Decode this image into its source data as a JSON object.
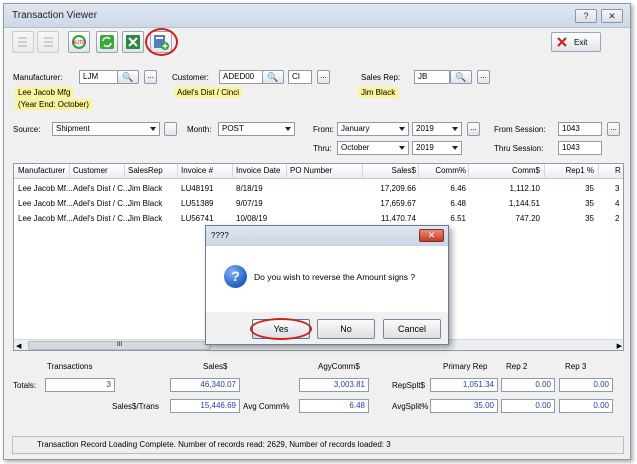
{
  "window": {
    "title": "Transaction Viewer",
    "help_label": "?",
    "close_label": "✕"
  },
  "toolbar": {
    "auto_label": "AUTO",
    "exit_label": "Exit"
  },
  "filters": {
    "manufacturer_label": "Manufacturer:",
    "manufacturer_value": "LJM",
    "manufacturer_name": "Lee Jacob Mfg",
    "manufacturer_note": "(Year End: October)",
    "customer_label": "Customer:",
    "customer_value": "ADED00",
    "customer_suffix": "CI",
    "customer_name": "Adel's Dist / Cinci",
    "salesrep_label": "Sales Rep:",
    "salesrep_value": "JB",
    "salesrep_name": "Jim Black",
    "more_label": "...",
    "source_label": "Source:",
    "source_value": "Shipment",
    "month_label": "Month:",
    "month_value": "POST",
    "from_label": "From:",
    "from_month": "January",
    "from_year": "2019",
    "thru_label": "Thru:",
    "thru_month": "October",
    "thru_year": "2019",
    "from_session_label": "From Session:",
    "from_session_value": "1043",
    "thru_session_label": "Thru Session:",
    "thru_session_value": "1043"
  },
  "grid": {
    "columns": [
      "Manufacturer",
      "Customer",
      "SalesRep",
      "Invoice #",
      "Invoice Date",
      "PO Number",
      "Sales$",
      "Comm%",
      "Comm$",
      "Rep1 %",
      "R"
    ],
    "rows": [
      [
        "Lee Jacob Mf...",
        "Adel's Dist / C...",
        "Jim Black",
        "LU48191",
        "8/18/19",
        "",
        "17,209.66",
        "6.46",
        "1,112.10",
        "35",
        "3"
      ],
      [
        "Lee Jacob Mf...",
        "Adel's Dist / C...",
        "Jim Black",
        "LU51389",
        "9/07/19",
        "",
        "17,659.67",
        "6.48",
        "1,144.51",
        "35",
        "4"
      ],
      [
        "Lee Jacob Mf...",
        "Adel's Dist / C...",
        "Jim Black",
        "LU56741",
        "10/08/19",
        "",
        "11,470.74",
        "6.51",
        "747.20",
        "35",
        "2"
      ]
    ],
    "scroll_grip": "III"
  },
  "totals": {
    "transactions_label": "Transactions",
    "sales_label": "Sales$",
    "agycomm_label": "AgyComm$",
    "primary_rep_label": "Primary Rep",
    "rep2_label": "Rep 2",
    "rep3_label": "Rep 3",
    "totals_label": "Totals:",
    "transactions": "3",
    "sales": "46,340.07",
    "agycomm": "3,003.81",
    "repsplit_label": "RepSplt$",
    "primary_rep": "1,051.34",
    "rep2": "0.00",
    "rep3": "0.00",
    "sales_trans_label": "Sales$/Trans",
    "sales_trans": "15,446.69",
    "avg_comm_label": "Avg Comm%",
    "avg_comm": "6.48",
    "avgsplit_label": "AvgSplit%",
    "avgsplit": "35.00",
    "rep2_split": "0.00",
    "rep3_split": "0.00"
  },
  "status": {
    "text": "Transaction Record Loading Complete.   Number of records read: 2629,    Number of records loaded: 3"
  },
  "dialog": {
    "title": "????",
    "message": "Do you wish to reverse the Amount signs ?",
    "icon_glyph": "?",
    "yes_label": "Yes",
    "no_label": "No",
    "cancel_label": "Cancel",
    "close_label": "✕"
  },
  "colors": {
    "accent_ring": "#d0201c",
    "highlight": "#fbf29a",
    "value_text": "#2540a8"
  }
}
